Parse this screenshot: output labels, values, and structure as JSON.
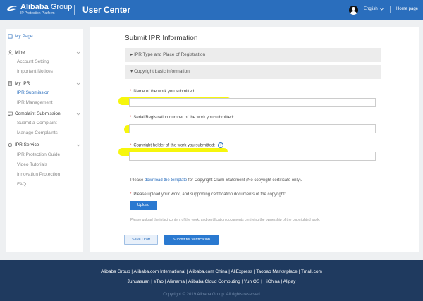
{
  "header": {
    "logo_main": "Alibaba",
    "logo_main_light": " Group",
    "logo_sub": "IP Protection Platform",
    "title": "User Center",
    "language": "English",
    "home": "Home page"
  },
  "sidebar": {
    "my_page": "My Page",
    "mine": {
      "label": "Mine",
      "items": [
        "Account Setting",
        "Important Notices"
      ]
    },
    "my_ipr": {
      "label": "My IPR",
      "items": [
        "IPR Submission",
        "IPR Management"
      ]
    },
    "complaint": {
      "label": "Complaint Submission",
      "items": [
        "Submit a Complaint",
        "Manage Complaints"
      ]
    },
    "ipr_service": {
      "label": "IPR Service",
      "items": [
        "IPR Protection Guide",
        "Video Tutorials",
        "Innovation Protection",
        "FAQ"
      ]
    }
  },
  "main": {
    "title": "Submit IPR Information",
    "section1": "IPR Type and Place of Registration",
    "section2": "Copyright basic information",
    "field1_label": "Name of the work you submitted:",
    "field2_label": "Serial/Registration number of the work you submitted:",
    "field3_label": "Copyright holder of the work you submitted:",
    "field1_value": "",
    "field2_value": "",
    "field3_value": "",
    "template_pre": "Please ",
    "template_link": "download the template",
    "template_post": " for Copyright Claim Statement (No copyright certificate only).",
    "upload_label": "Please upload your work, and supporting certification documents of the copyright:",
    "upload_button": "Upload",
    "upload_note": "Please upload the intact content of the work, and certification documents certifying the ownership of the copyrighted work.",
    "save_draft": "Save Draft",
    "submit": "Submit for verification"
  },
  "footer": {
    "row1": "Alibaba Group | Alibaba.com International | Alibaba.com China | AliExpress | Taobao Marketplace | Tmall.com",
    "row2": "Juhuasuan | eTao | Alimama | Alibaba Cloud Computing | Yun OS | HiChina | Alipay",
    "copyright": "Copyright © 2019 Alibaba Group. All rights reserved"
  },
  "colors": {
    "brand_blue": "#2a6ebd",
    "footer_bg": "#1f3a5f",
    "highlight": "#f5f500"
  }
}
